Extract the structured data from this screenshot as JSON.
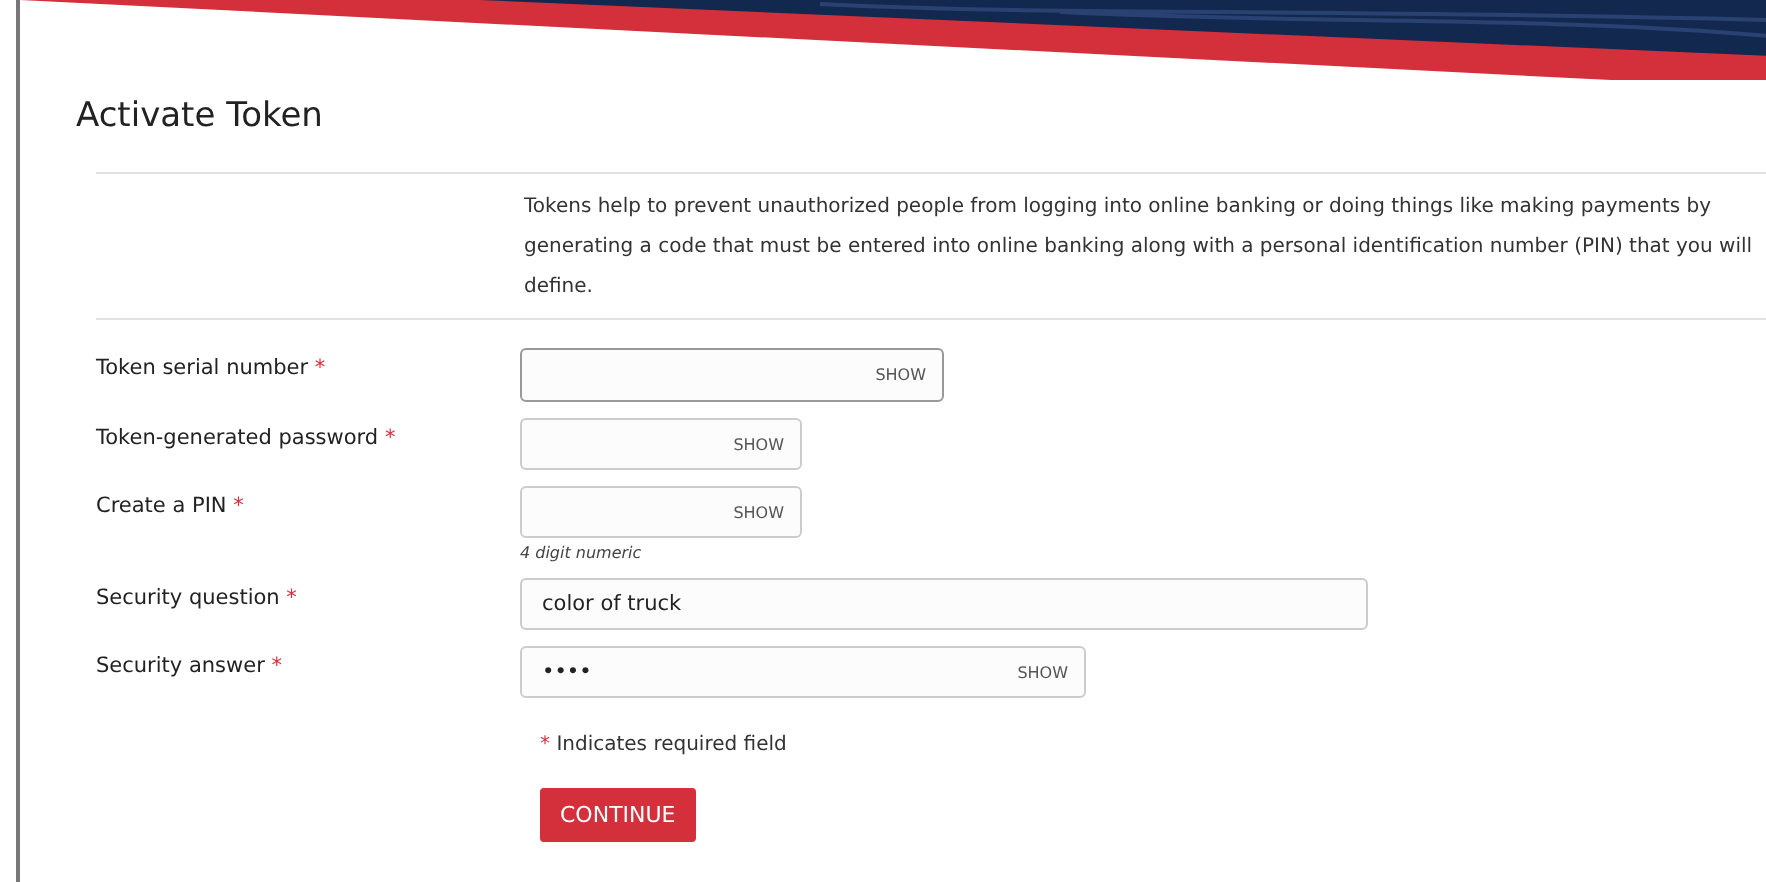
{
  "title": "Activate Token",
  "description": "Tokens help to prevent unauthorized people from logging into online banking or doing things like making payments by generating a code that must be entered into online banking along with a personal identification number (PIN) that you will define.",
  "fields": [
    {
      "label": "Token serial number",
      "marker": "*",
      "kind": "secret",
      "toggle": "SHOW"
    },
    {
      "label": "Token-generated password",
      "marker": "*",
      "kind": "secret",
      "toggle": "SHOW"
    },
    {
      "label": "Create a PIN",
      "marker": "*",
      "kind": "secret",
      "toggle": "SHOW",
      "hint": "4 digit numeric"
    },
    {
      "label": "Security question",
      "marker": "*",
      "kind": "plain",
      "value": "color of truck"
    },
    {
      "label": "Security answer",
      "marker": "*",
      "kind": "secret",
      "toggle": "SHOW",
      "value": "••••"
    }
  ],
  "required_note": {
    "marker": "*",
    "text": "Indicates required field"
  },
  "button": "CONTINUE"
}
